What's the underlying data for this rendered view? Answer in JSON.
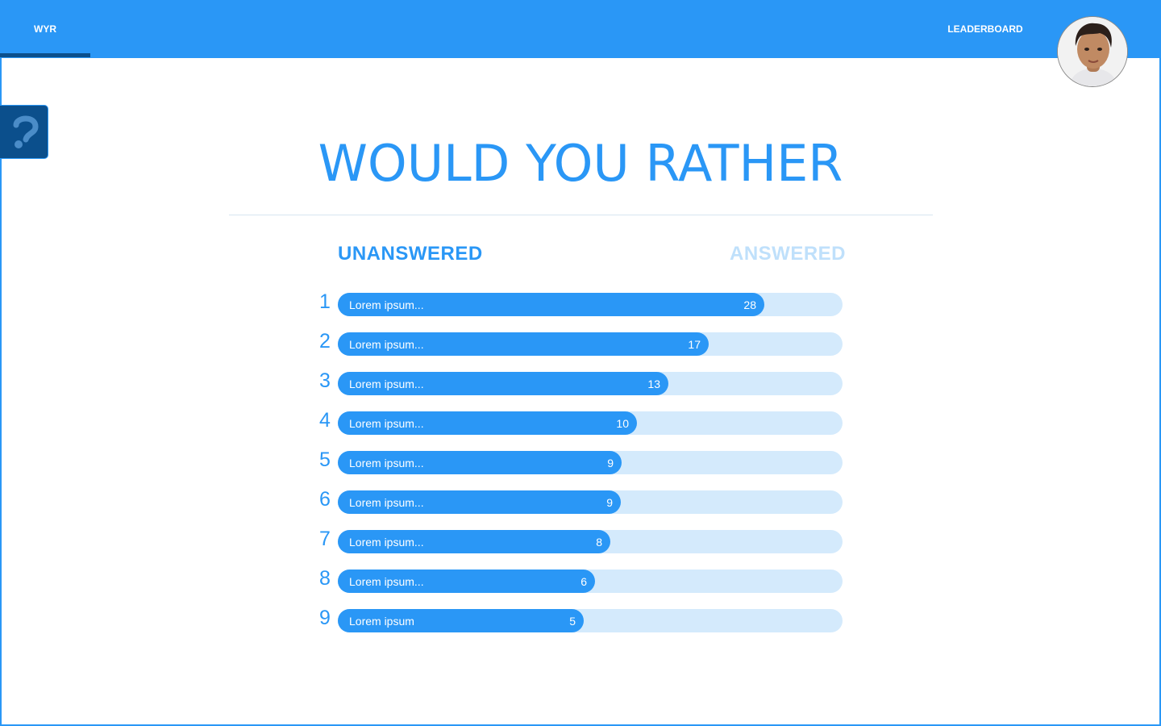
{
  "nav": {
    "home_label": "WYR",
    "leaderboard_label": "LEADERBOARD"
  },
  "title": "WOULD YOU RATHER",
  "tabs": {
    "unanswered": "UNANSWERED",
    "answered": "ANSWERED",
    "active": "unanswered"
  },
  "colors": {
    "primary": "#2a97f6",
    "dark": "#0b4f8c",
    "track": "#d4eafc",
    "inactive_tab": "#bfe0fb"
  },
  "icons": {
    "help": "question-mark-icon",
    "avatar": "user-avatar"
  },
  "questions": [
    {
      "rank": "1",
      "text": "Lorem ipsum...",
      "count": 28
    },
    {
      "rank": "2",
      "text": "Lorem ipsum...",
      "count": 17
    },
    {
      "rank": "3",
      "text": "Lorem ipsum...",
      "count": 13
    },
    {
      "rank": "4",
      "text": "Lorem ipsum...",
      "count": 10
    },
    {
      "rank": "5",
      "text": "Lorem ipsum...",
      "count": 9
    },
    {
      "rank": "6",
      "text": "Lorem ipsum...",
      "count": 9
    },
    {
      "rank": "7",
      "text": "Lorem ipsum...",
      "count": 8
    },
    {
      "rank": "8",
      "text": "Lorem ipsum...",
      "count": 6
    },
    {
      "rank": "9",
      "text": "Lorem ipsum",
      "count": 5
    }
  ],
  "bar_fill_fraction": [
    0.845,
    0.735,
    0.655,
    0.593,
    0.562,
    0.56,
    0.54,
    0.509,
    0.487
  ]
}
